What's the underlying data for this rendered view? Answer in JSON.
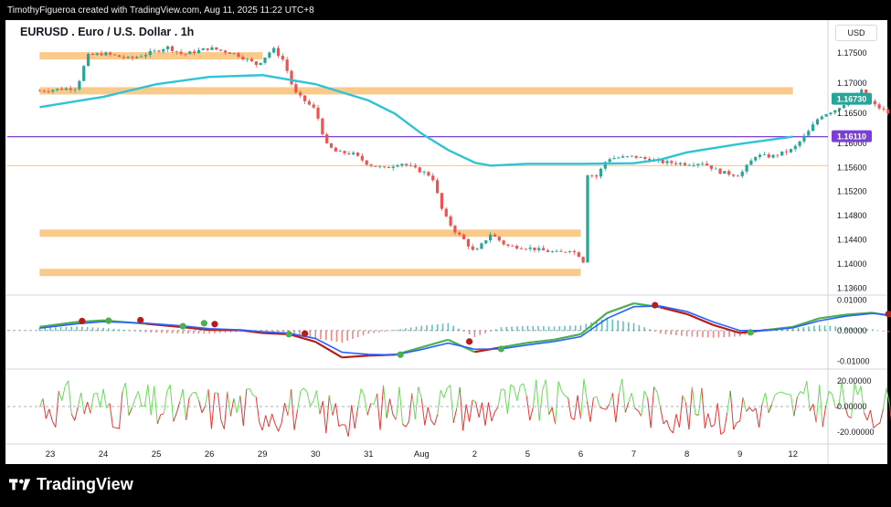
{
  "header": {
    "attribution": "TimothyFigueroa created with TradingView.com, Aug 11, 2025 11:22 UTC+8"
  },
  "chart_header": {
    "symbol_title": "EURUSD . Euro / U.S. Dollar . 1h",
    "currency": "USD"
  },
  "brand": {
    "name": "TradingView"
  },
  "colors": {
    "up": "#26a69a",
    "down": "#ef5350",
    "ma": "#2ec4d6",
    "zone": "#f9c784",
    "purple": "#7b3fd6",
    "green_line": "#4caf50",
    "red_line": "#b71c1c",
    "blue_line": "#2962ff"
  },
  "chart_data": [
    {
      "type": "candlestick",
      "title": "EURUSD . Euro / U.S. Dollar . 1h",
      "x_tick_labels": [
        "23",
        "24",
        "25",
        "26",
        "29",
        "30",
        "31",
        "Aug",
        "2",
        "5",
        "6",
        "7",
        "8",
        "9",
        "12"
      ],
      "y_tick_labels": [
        "1.17500",
        "1.17000",
        "1.16500",
        "1.16000",
        "1.15600",
        "1.15200",
        "1.14800",
        "1.14400",
        "1.14000",
        "1.13600"
      ],
      "ylim": [
        1.135,
        1.178
      ],
      "price_badges": [
        {
          "label": "1.16730",
          "value": 1.1673,
          "color": "#26a69a"
        },
        {
          "label": "1.16110",
          "value": 1.1611,
          "color": "#7b3fd6"
        }
      ],
      "horizontal_lines": [
        {
          "value": 1.1611,
          "color": "#7b3fd6"
        },
        {
          "value": 1.1563,
          "color": "#f9c784"
        }
      ],
      "zones": [
        {
          "from_x": -0.2,
          "to_x": 4.0,
          "value": 1.1745
        },
        {
          "from_x": -0.2,
          "to_x": 14.0,
          "value": 1.1687
        },
        {
          "from_x": -0.2,
          "to_x": 10.0,
          "value": 1.1451
        },
        {
          "from_x": -0.2,
          "to_x": 10.0,
          "value": 1.1386
        }
      ],
      "moving_average": [
        [
          -0.2,
          1.166
        ],
        [
          0.5,
          1.167
        ],
        [
          1.0,
          1.1677
        ],
        [
          2.0,
          1.1698
        ],
        [
          3.0,
          1.171
        ],
        [
          4.0,
          1.1713
        ],
        [
          5.0,
          1.1698
        ],
        [
          6.0,
          1.1671
        ],
        [
          6.5,
          1.1649
        ],
        [
          7.0,
          1.1616
        ],
        [
          7.5,
          1.1589
        ],
        [
          8.0,
          1.1568
        ],
        [
          8.3,
          1.1563
        ],
        [
          9.0,
          1.1566
        ],
        [
          10.0,
          1.1566
        ],
        [
          11.0,
          1.1567
        ],
        [
          11.5,
          1.1573
        ],
        [
          12.0,
          1.1585
        ],
        [
          13.0,
          1.1599
        ],
        [
          14.0,
          1.1611
        ]
      ],
      "price_path": [
        [
          -0.2,
          1.1687
        ],
        [
          0.2,
          1.169
        ],
        [
          0.5,
          1.1692
        ],
        [
          0.7,
          1.1745
        ],
        [
          1.0,
          1.1749
        ],
        [
          1.5,
          1.174
        ],
        [
          2.0,
          1.1753
        ],
        [
          2.2,
          1.176
        ],
        [
          2.5,
          1.1747
        ],
        [
          3.0,
          1.1758
        ],
        [
          3.5,
          1.1748
        ],
        [
          3.9,
          1.173
        ],
        [
          4.2,
          1.1757
        ],
        [
          4.4,
          1.1737
        ],
        [
          4.6,
          1.1685
        ],
        [
          5.0,
          1.1655
        ],
        [
          5.2,
          1.1598
        ],
        [
          5.4,
          1.1585
        ],
        [
          5.7,
          1.1583
        ],
        [
          6.0,
          1.1565
        ],
        [
          6.3,
          1.1558
        ],
        [
          6.6,
          1.1568
        ],
        [
          7.0,
          1.1553
        ],
        [
          7.2,
          1.1545
        ],
        [
          7.4,
          1.1485
        ],
        [
          7.6,
          1.1457
        ],
        [
          7.8,
          1.144
        ],
        [
          8.0,
          1.1418
        ],
        [
          8.3,
          1.145
        ],
        [
          8.6,
          1.143
        ],
        [
          9.0,
          1.1427
        ],
        [
          9.3,
          1.1422
        ],
        [
          9.6,
          1.1418
        ],
        [
          9.8,
          1.1424
        ],
        [
          10.0,
          1.1412
        ],
        [
          10.05,
          1.1404
        ],
        [
          10.1,
          1.155
        ],
        [
          10.3,
          1.1545
        ],
        [
          10.5,
          1.1575
        ],
        [
          11.0,
          1.1578
        ],
        [
          11.5,
          1.1569
        ],
        [
          12.0,
          1.1566
        ],
        [
          12.3,
          1.1568
        ],
        [
          12.6,
          1.1553
        ],
        [
          12.9,
          1.1548
        ],
        [
          13.0,
          1.1548
        ],
        [
          13.3,
          1.158
        ],
        [
          13.6,
          1.1578
        ],
        [
          14.0,
          1.159
        ],
        [
          14.3,
          1.162
        ],
        [
          14.5,
          1.1645
        ],
        [
          14.8,
          1.1656
        ],
        [
          15.0,
          1.1668
        ],
        [
          15.3,
          1.1687
        ],
        [
          15.5,
          1.1665
        ],
        [
          15.8,
          1.165
        ],
        [
          16.0,
          1.1636
        ],
        [
          16.3,
          1.1672
        ],
        [
          16.6,
          1.1656
        ],
        [
          16.9,
          1.1657
        ],
        [
          17.1,
          1.1654
        ],
        [
          17.4,
          1.1661
        ],
        [
          17.6,
          1.1656
        ],
        [
          17.9,
          1.167
        ],
        [
          18.0,
          1.1673
        ]
      ]
    },
    {
      "type": "line",
      "title": "",
      "y_tick_labels": [
        "0.01000",
        "0.00000",
        "-0.01000"
      ],
      "ylim": [
        -0.012,
        0.011
      ],
      "series": [
        {
          "values": [
            [
              -0.2,
              0.0012
            ],
            [
              0.5,
              0.0028
            ],
            [
              1.0,
              0.0033
            ],
            [
              1.8,
              0.0022
            ],
            [
              2.5,
              0.0011
            ],
            [
              3.0,
              0.0002
            ],
            [
              3.6,
              0.0001
            ],
            [
              4.0,
              -0.0008
            ],
            [
              4.5,
              -0.0012
            ],
            [
              5.0,
              -0.0037
            ],
            [
              5.5,
              -0.0088
            ],
            [
              6.0,
              -0.0082
            ],
            [
              6.5,
              -0.0079
            ],
            [
              7.0,
              -0.0055
            ],
            [
              7.5,
              -0.003
            ],
            [
              8.0,
              -0.007
            ],
            [
              8.5,
              -0.0055
            ],
            [
              9.0,
              -0.004
            ],
            [
              9.5,
              -0.003
            ],
            [
              10.0,
              -0.0012
            ],
            [
              10.5,
              0.0058
            ],
            [
              11.0,
              0.0089
            ],
            [
              11.5,
              0.0076
            ],
            [
              12.0,
              0.0054
            ],
            [
              12.5,
              0.0018
            ],
            [
              13.0,
              -0.0008
            ],
            [
              13.5,
              0.0002
            ],
            [
              14.0,
              0.0012
            ],
            [
              14.5,
              0.004
            ],
            [
              15.0,
              0.0052
            ],
            [
              15.5,
              0.0058
            ],
            [
              16.0,
              0.0043
            ],
            [
              16.5,
              0.0012
            ],
            [
              17.0,
              -0.0004
            ],
            [
              17.5,
              -0.0011
            ],
            [
              18.0,
              -0.0008
            ]
          ]
        },
        {
          "values": [
            [
              -0.2,
              0.0008
            ],
            [
              0.5,
              0.0022
            ],
            [
              1.0,
              0.0029
            ],
            [
              1.8,
              0.0024
            ],
            [
              2.5,
              0.0015
            ],
            [
              3.0,
              0.0006
            ],
            [
              3.6,
              0.0002
            ],
            [
              4.0,
              -0.0004
            ],
            [
              4.5,
              -0.0009
            ],
            [
              5.0,
              -0.0026
            ],
            [
              5.5,
              -0.0071
            ],
            [
              6.0,
              -0.0078
            ],
            [
              6.5,
              -0.008
            ],
            [
              7.0,
              -0.0062
            ],
            [
              7.5,
              -0.0041
            ],
            [
              8.0,
              -0.0061
            ],
            [
              8.5,
              -0.006
            ],
            [
              9.0,
              -0.0047
            ],
            [
              9.5,
              -0.0036
            ],
            [
              10.0,
              -0.002
            ],
            [
              10.5,
              0.004
            ],
            [
              11.0,
              0.0078
            ],
            [
              11.5,
              0.008
            ],
            [
              12.0,
              0.0062
            ],
            [
              12.5,
              0.0028
            ],
            [
              13.0,
              0.0
            ],
            [
              13.5,
              0.0
            ],
            [
              14.0,
              0.0009
            ],
            [
              14.5,
              0.0032
            ],
            [
              15.0,
              0.0047
            ],
            [
              15.5,
              0.0056
            ],
            [
              16.0,
              0.0048
            ],
            [
              16.5,
              0.002
            ],
            [
              17.0,
              0.0002
            ],
            [
              17.5,
              -0.0008
            ],
            [
              18.0,
              -0.0008
            ]
          ]
        }
      ],
      "markers": [
        {
          "x": 0.6,
          "y": 0.0031,
          "color": "#b71c1c"
        },
        {
          "x": 1.1,
          "y": 0.0032,
          "color": "#4caf50"
        },
        {
          "x": 1.7,
          "y": 0.0034,
          "color": "#b71c1c"
        },
        {
          "x": 2.5,
          "y": 0.0014,
          "color": "#4caf50"
        },
        {
          "x": 2.9,
          "y": 0.0024,
          "color": "#4caf50"
        },
        {
          "x": 3.1,
          "y": 0.0021,
          "color": "#b71c1c"
        },
        {
          "x": 4.5,
          "y": -0.0012,
          "color": "#4caf50"
        },
        {
          "x": 4.8,
          "y": -0.001,
          "color": "#b71c1c"
        },
        {
          "x": 6.6,
          "y": -0.0079,
          "color": "#4caf50"
        },
        {
          "x": 7.9,
          "y": -0.0036,
          "color": "#b71c1c"
        },
        {
          "x": 8.5,
          "y": -0.006,
          "color": "#4caf50"
        },
        {
          "x": 11.4,
          "y": 0.0083,
          "color": "#b71c1c"
        },
        {
          "x": 13.2,
          "y": -0.0006,
          "color": "#4caf50"
        },
        {
          "x": 15.8,
          "y": 0.0054,
          "color": "#b71c1c"
        },
        {
          "x": 17.9,
          "y": -0.0008,
          "color": "#4caf50"
        }
      ]
    },
    {
      "type": "line",
      "title": "",
      "y_tick_labels": [
        "20.00000",
        "0.00000",
        "-20.00000"
      ],
      "ylim": [
        -28,
        28
      ]
    }
  ]
}
